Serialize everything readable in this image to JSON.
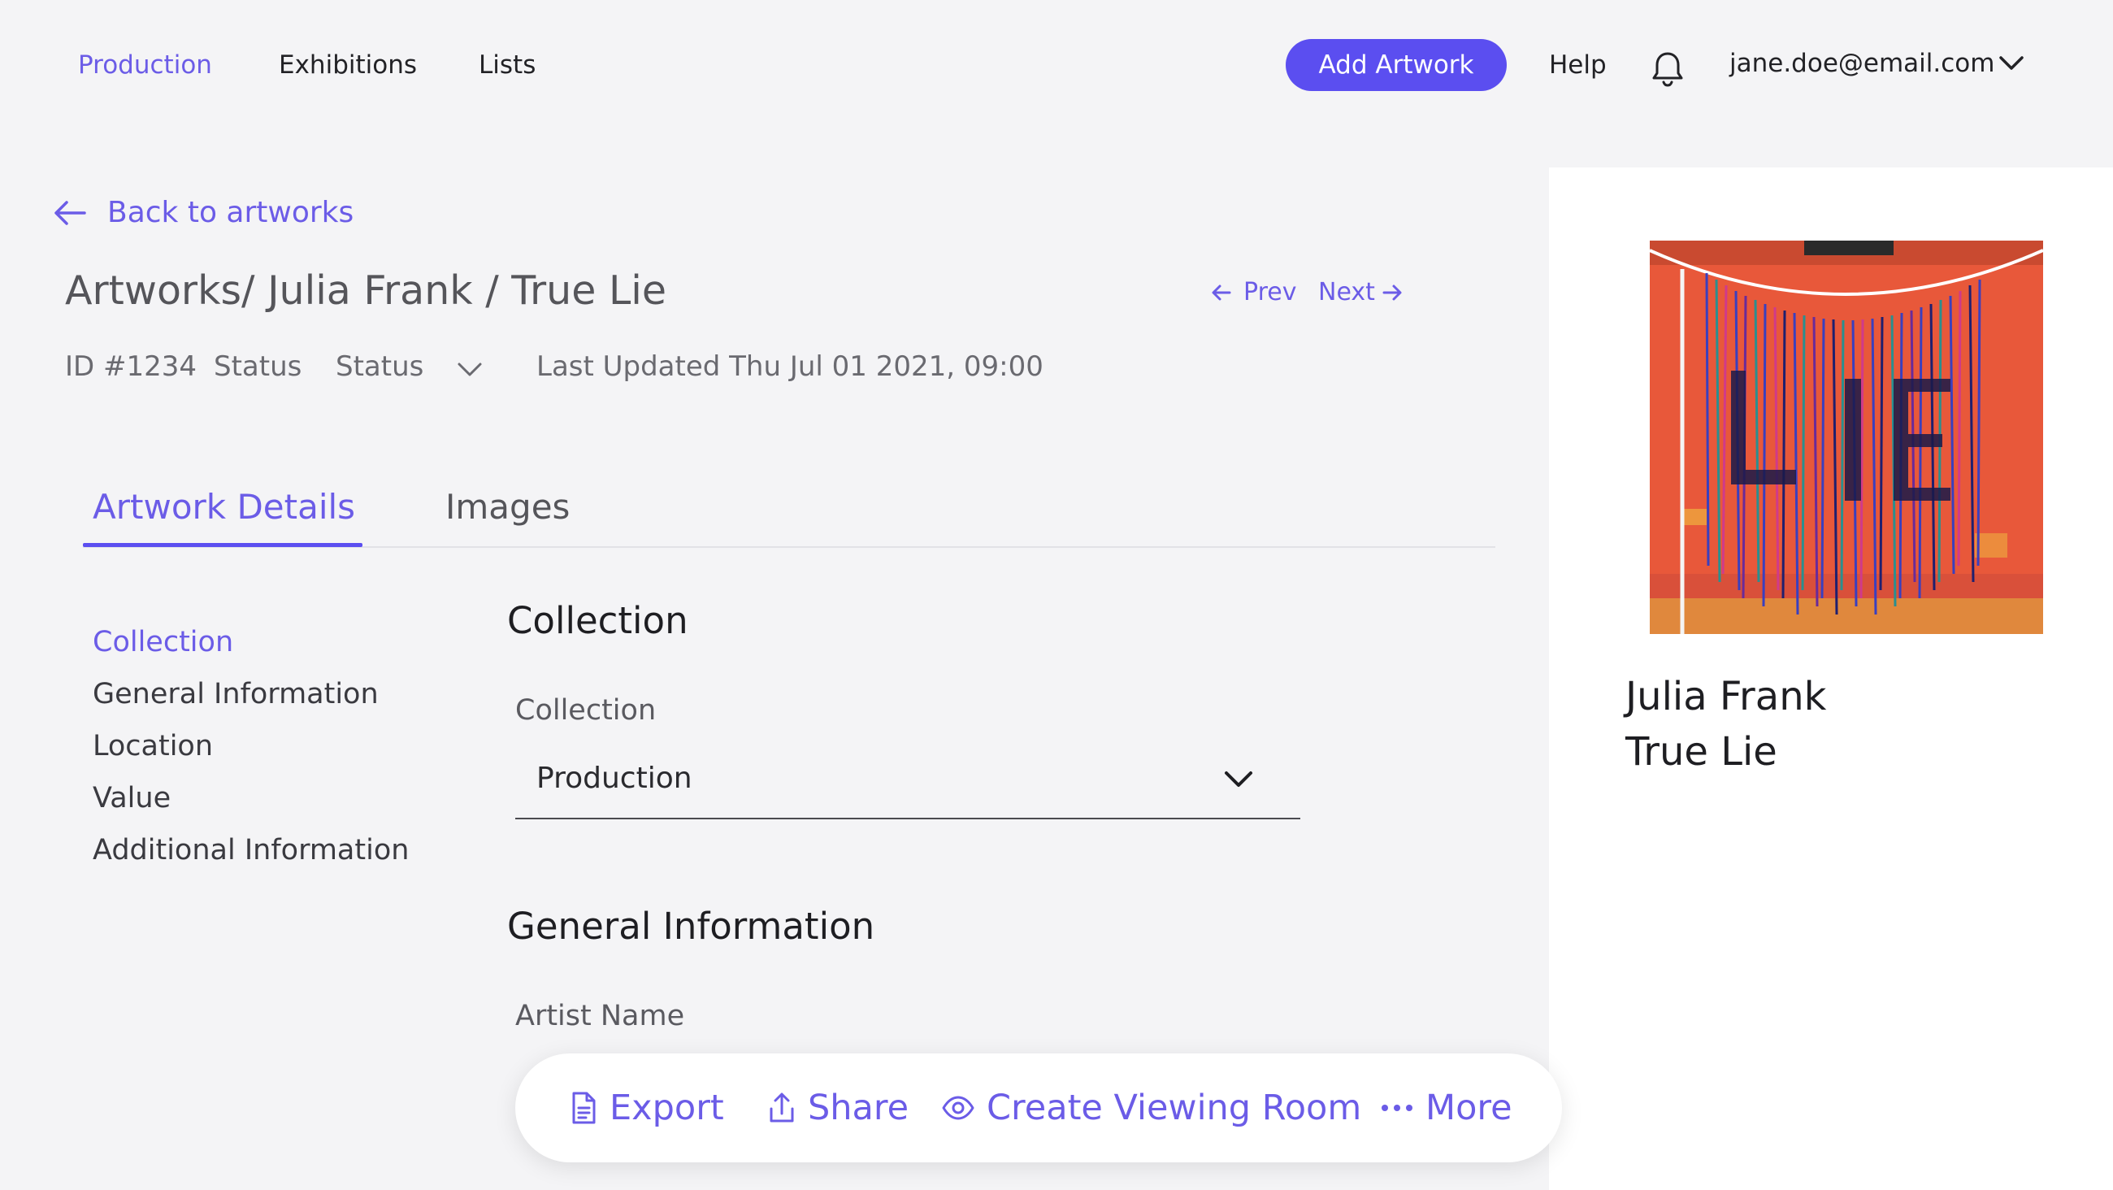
{
  "nav": {
    "items": [
      {
        "label": "Production",
        "active": true
      },
      {
        "label": "Exhibitions",
        "active": false
      },
      {
        "label": "Lists",
        "active": false
      }
    ],
    "add_artwork_label": "Add Artwork",
    "help_label": "Help",
    "user_email": "jane.doe@email.com"
  },
  "header": {
    "back_label": "Back to artworks",
    "breadcrumb": "Artworks/ Julia Frank / True Lie",
    "prev_label": "Prev",
    "next_label": "Next",
    "id_label": "ID #1234",
    "status_label": "Status",
    "status_value": "Status",
    "last_updated": "Last Updated Thu Jul 01 2021, 09:00"
  },
  "tabs": [
    {
      "label": "Artwork Details",
      "active": true
    },
    {
      "label": "Images",
      "active": false
    }
  ],
  "sidebar": {
    "items": [
      {
        "label": "Collection",
        "active": true
      },
      {
        "label": "General Information",
        "active": false
      },
      {
        "label": "Location",
        "active": false
      },
      {
        "label": "Value",
        "active": false
      },
      {
        "label": "Additional Information",
        "active": false
      }
    ]
  },
  "form": {
    "collection_section_title": "Collection",
    "collection_field_label": "Collection",
    "collection_value": "Production",
    "general_section_title": "General Information",
    "artist_name_label": "Artist Name"
  },
  "preview": {
    "artist": "Julia Frank",
    "title": "True Lie"
  },
  "action_bar": {
    "export_label": "Export",
    "share_label": "Share",
    "viewing_room_label": "Create Viewing Room",
    "more_label": "More"
  },
  "colors": {
    "accent": "#6b5ce7",
    "button": "#5b4ef0",
    "background": "#f4f4f6"
  }
}
